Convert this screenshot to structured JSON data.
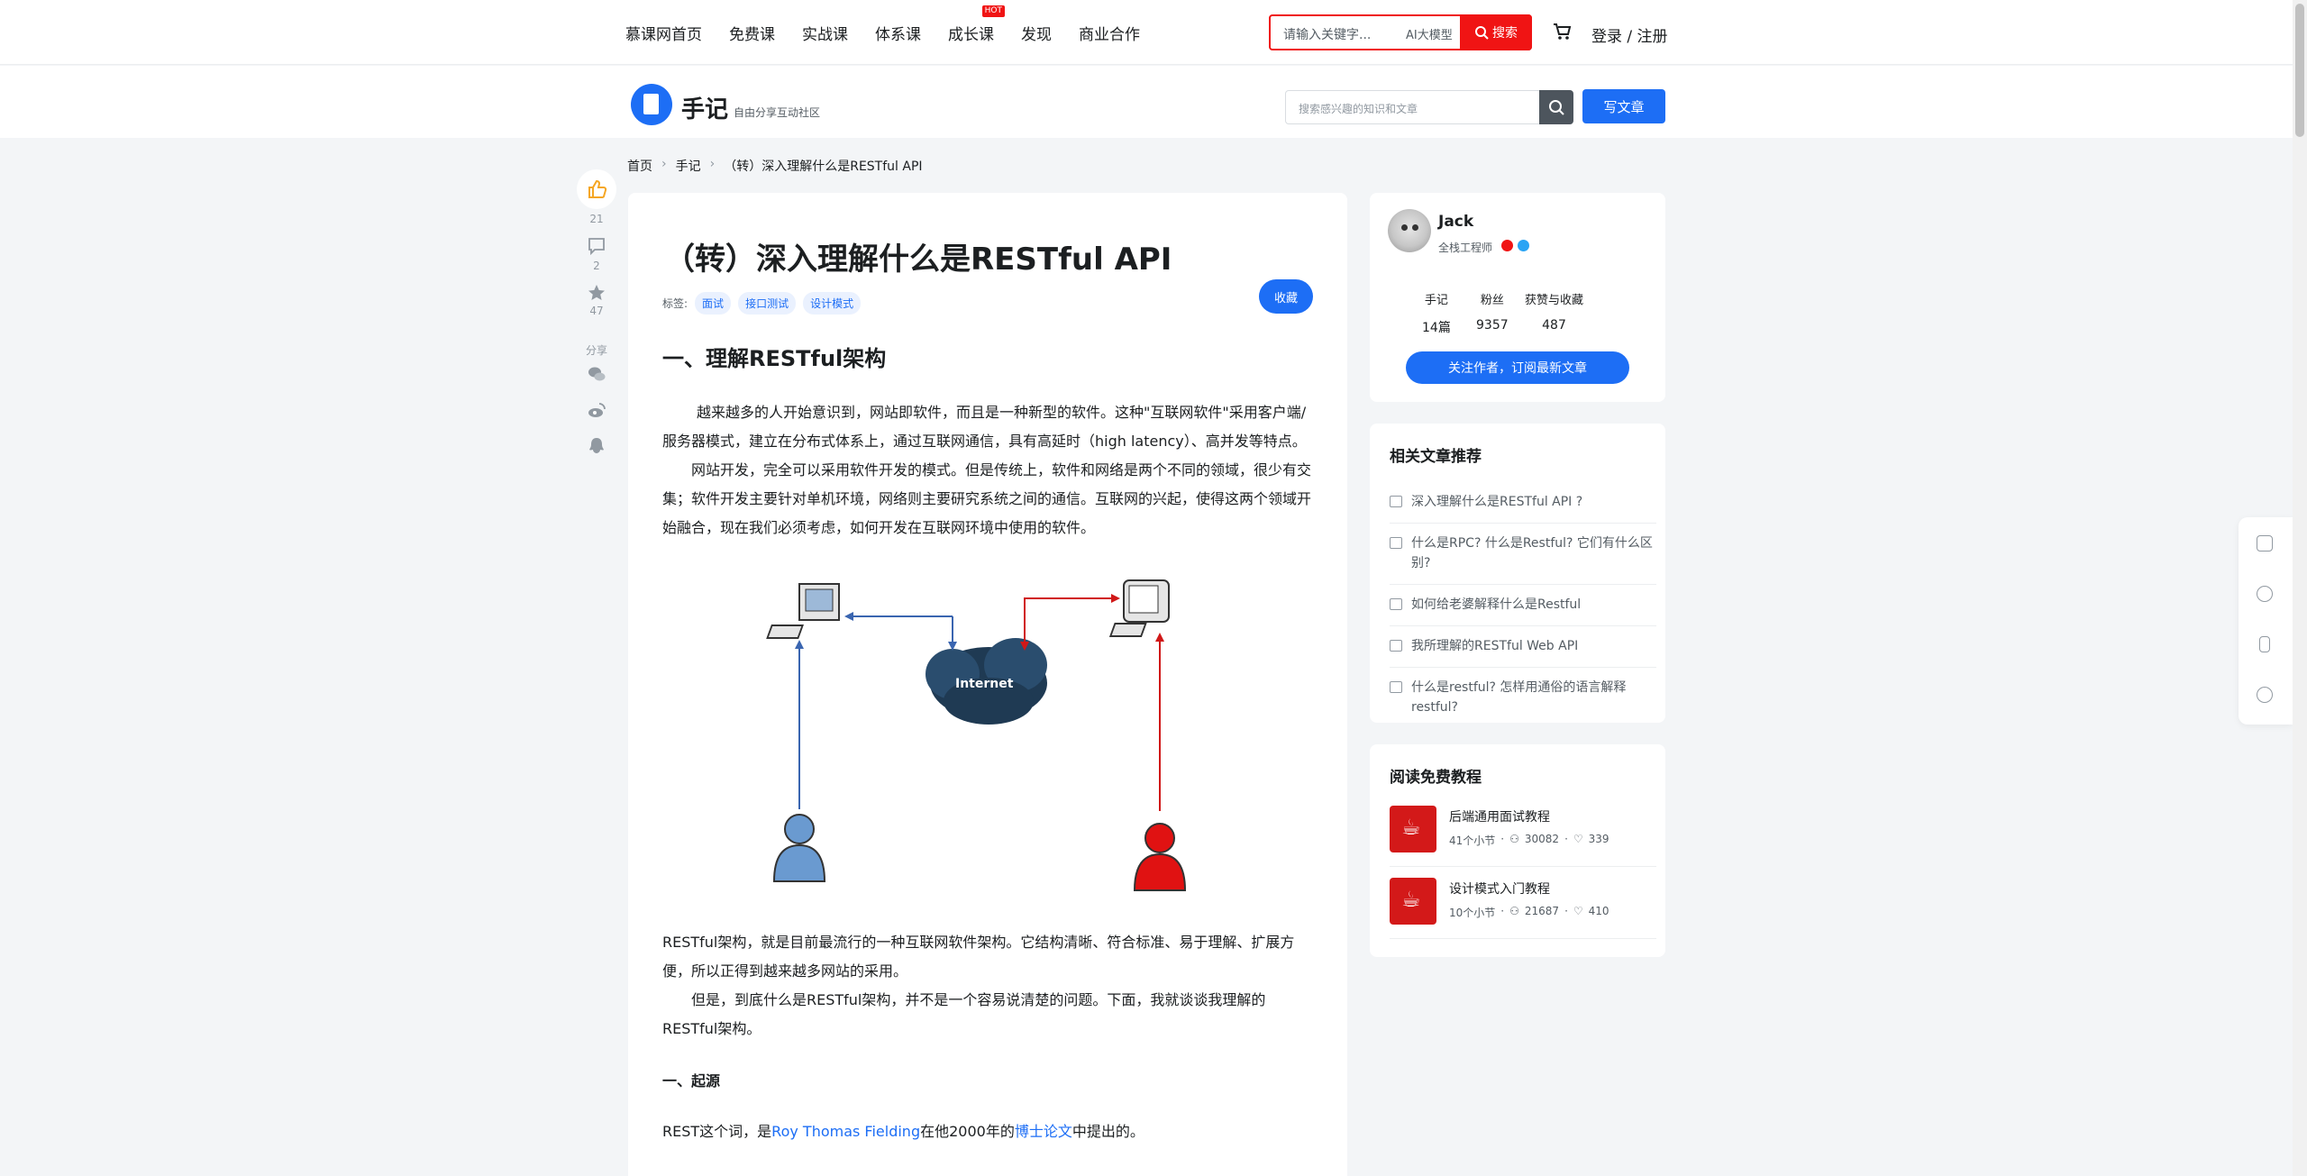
{
  "topnav": {
    "items": [
      "慕课网首页",
      "免费课",
      "实战课",
      "体系课",
      "成长课",
      "发现",
      "商业合作"
    ],
    "hot_badge": "HOT",
    "search_placeholder": "请输入关键字...",
    "ai_label": "AI大模型",
    "search_button": "搜索",
    "login_label": "登录 / 注册"
  },
  "subheader": {
    "brand": "手记",
    "brand_sub": "自由分享互动社区",
    "search_placeholder": "搜索感兴趣的知识和文章",
    "write_button": "写文章"
  },
  "breadcrumb": [
    "首页",
    "手记",
    "（转）深入理解什么是RESTful API"
  ],
  "leftbar": {
    "like_count": "21",
    "comment_count": "2",
    "star_count": "47",
    "share_label": "分享"
  },
  "article": {
    "title": "（转）深入理解什么是RESTful API",
    "tags_label": "标签:",
    "tags": [
      "面试",
      "接口测试",
      "设计模式"
    ],
    "collect_button": "收藏",
    "section_title": "一、理解RESTful架构",
    "p1": "越来越多的人开始意识到，网站即软件，而且是一种新型的软件。这种\"互联网软件\"采用客户端/服务器模式，建立在分布式体系上，通过互联网通信，具有高延时（high latency）、高并发等特点。",
    "p2": "网站开发，完全可以采用软件开发的模式。但是传统上，软件和网络是两个不同的领域，很少有交集；软件开发主要针对单机环境，网络则主要研究系统之间的通信。互联网的兴起，使得这两个领域开始融合，现在我们必须考虑，如何开发在互联网环境中使用的软件。",
    "diagram_label": "Internet",
    "p3": "RESTful架构，就是目前最流行的一种互联网软件架构。它结构清晰、符合标准、易于理解、扩展方便，所以正得到越来越多网站的采用。",
    "p4": "但是，到底什么是RESTful架构，并不是一个容易说清楚的问题。下面，我就谈谈我理解的RESTful架构。",
    "h3": "一、起源",
    "p5_a": "REST这个词，是",
    "p5_link1": "Roy Thomas Fielding",
    "p5_b": "在他2000年的",
    "p5_link2": "博士论文",
    "p5_c": "中提出的。"
  },
  "author": {
    "name": "Jack",
    "title": "全栈工程师",
    "stats": [
      {
        "label": "手记",
        "value": "14篇"
      },
      {
        "label": "粉丝",
        "value": "9357"
      },
      {
        "label": "获赞与收藏",
        "value": "487"
      }
    ],
    "follow_button": "关注作者，订阅最新文章"
  },
  "related": {
    "title": "相关文章推荐",
    "items": [
      "深入理解什么是RESTful API ?",
      "什么是RPC? 什么是Restful? 它们有什么区别?",
      "如何给老婆解释什么是Restful",
      "我所理解的RESTful Web API",
      "什么是restful? 怎样用通俗的语言解释restful?"
    ]
  },
  "free_courses": {
    "title": "阅读免费教程",
    "items": [
      {
        "name": "后端通用面试教程",
        "sections": "41个小节",
        "learners": "30082",
        "likes": "339"
      },
      {
        "name": "设计模式入门教程",
        "sections": "10个小节",
        "learners": "21687",
        "likes": "410"
      }
    ]
  },
  "colors": {
    "primary": "#1d6ef5",
    "accent": "#f01414"
  }
}
